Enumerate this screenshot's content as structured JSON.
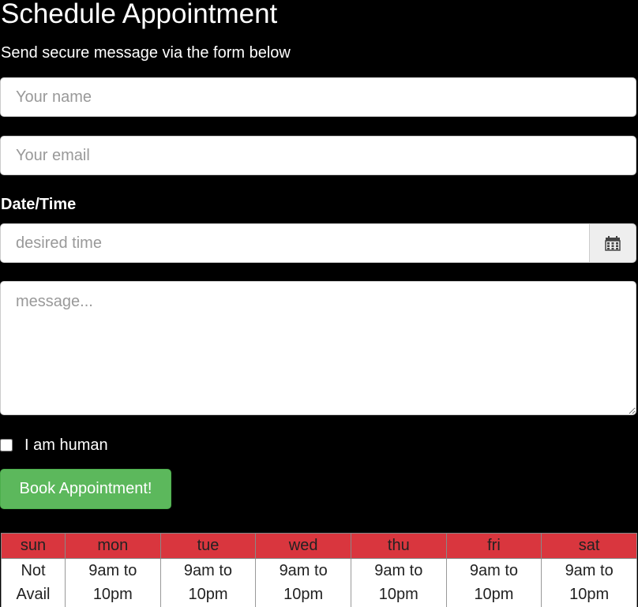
{
  "heading": "Schedule Appointment",
  "subtitle": "Send secure message via the form below",
  "form": {
    "name_placeholder": "Your name",
    "email_placeholder": "Your email",
    "datetime_label": "Date/Time",
    "datetime_placeholder": "desired time",
    "datetime_icon": "calendar-icon",
    "message_placeholder": "message...",
    "human_label": "I am human",
    "human_checked": false,
    "submit_label": "Book Appointment!"
  },
  "schedule": {
    "header_color": "#d9363e",
    "days": [
      {
        "day": "sun",
        "line1": "Not",
        "line2": "Avail"
      },
      {
        "day": "mon",
        "line1": "9am to",
        "line2": "10pm"
      },
      {
        "day": "tue",
        "line1": "9am to",
        "line2": "10pm"
      },
      {
        "day": "wed",
        "line1": "9am to",
        "line2": "10pm"
      },
      {
        "day": "thu",
        "line1": "9am to",
        "line2": "10pm"
      },
      {
        "day": "fri",
        "line1": "9am to",
        "line2": "10pm"
      },
      {
        "day": "sat",
        "line1": "9am to",
        "line2": "10pm"
      }
    ]
  },
  "colors": {
    "background": "#000000",
    "button": "#5cb85c"
  }
}
